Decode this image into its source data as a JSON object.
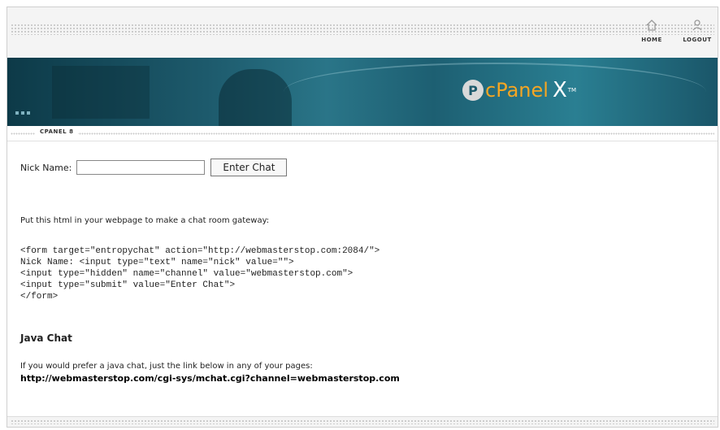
{
  "header": {
    "links": [
      {
        "label": "HOME",
        "icon": "home-icon"
      },
      {
        "label": "LOGOUT",
        "icon": "logout-icon"
      }
    ]
  },
  "banner": {
    "brand_mark": "P",
    "brand_text": "cPanel",
    "brand_version": "X",
    "brand_tm": "TM",
    "colors": {
      "accent": "#f5a623",
      "banner": "#1d5a6c"
    }
  },
  "subnav": {
    "label": "CPANEL 8"
  },
  "form": {
    "nick_label": "Nick Name:",
    "nick_value": "",
    "nick_placeholder": "",
    "enter_label": "Enter Chat"
  },
  "instructions": "Put this html in your webpage to make a chat room gateway:",
  "code_lines": [
    "<form target=\"entropychat\" action=\"http://webmasterstop.com:2084/\">",
    "Nick Name: <input type=\"text\" name=\"nick\" value=\"\">",
    "<input type=\"hidden\" name=\"channel\" value=\"webmasterstop.com\">",
    "<input type=\"submit\" value=\"Enter Chat\">",
    "</form>"
  ],
  "java": {
    "heading": "Java Chat",
    "description": "If you would prefer a java chat, just the link below in any of your pages:",
    "link": "http://webmasterstop.com/cgi-sys/mchat.cgi?channel=webmasterstop.com"
  }
}
